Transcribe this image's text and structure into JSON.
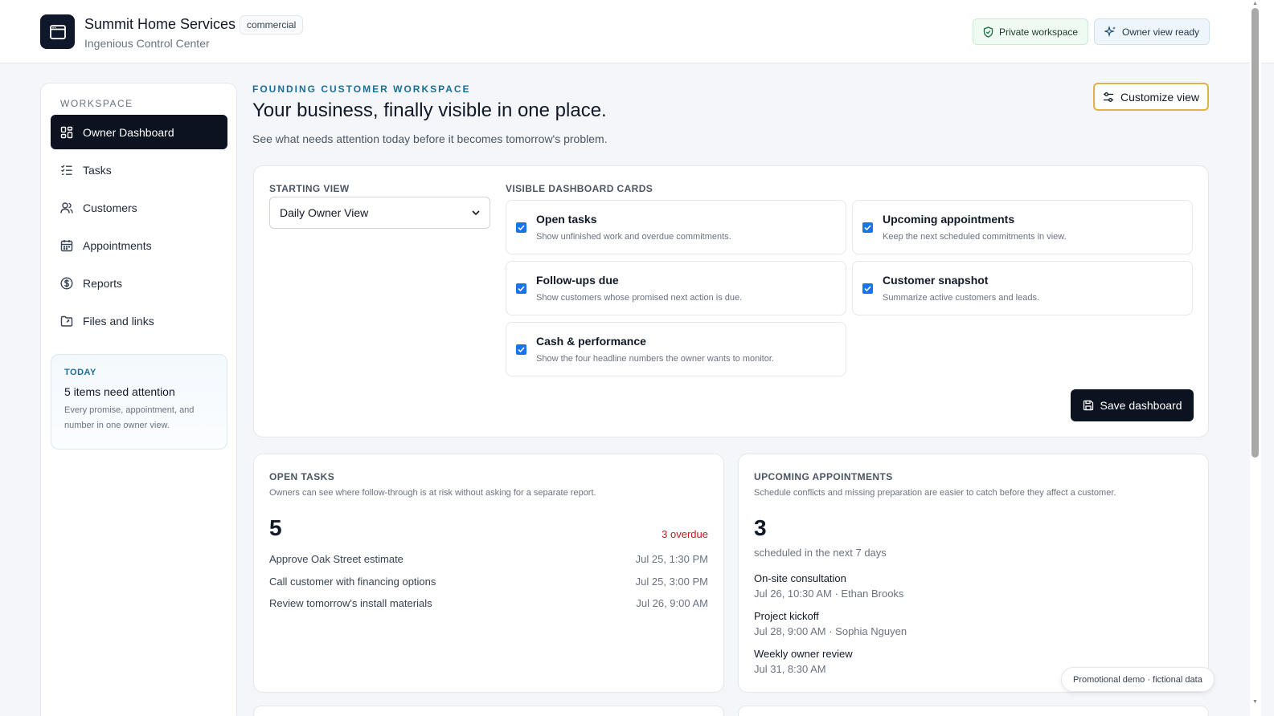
{
  "header": {
    "app_title": "Summit Home Services",
    "badge": "commercial",
    "subtitle": "Ingenious Control Center",
    "private_pill": "Private workspace",
    "owner_pill": "Owner view ready"
  },
  "sidebar": {
    "section_label": "WORKSPACE",
    "items": [
      {
        "label": "Owner Dashboard",
        "icon": "dashboard-icon",
        "active": true
      },
      {
        "label": "Tasks",
        "icon": "checklist-icon"
      },
      {
        "label": "Customers",
        "icon": "users-icon"
      },
      {
        "label": "Appointments",
        "icon": "calendar-icon"
      },
      {
        "label": "Reports",
        "icon": "dollar-circle-icon"
      },
      {
        "label": "Files and links",
        "icon": "folder-link-icon"
      }
    ],
    "today": {
      "tag": "TODAY",
      "title": "5 items need attention",
      "description": "Every promise, appointment, and number in one owner view."
    }
  },
  "main": {
    "eyebrow": "FOUNDING CUSTOMER WORKSPACE",
    "title": "Your business, finally visible in one place.",
    "subtitle": "See what needs attention today before it becomes tomorrow's problem.",
    "customize_label": "Customize view"
  },
  "settings": {
    "starting_view_label": "STARTING VIEW",
    "starting_view_value": "Daily Owner View",
    "cards_label": "VISIBLE DASHBOARD CARDS",
    "cards": [
      {
        "title": "Open tasks",
        "desc": "Show unfinished work and overdue commitments.",
        "checked": true
      },
      {
        "title": "Upcoming appointments",
        "desc": "Keep the next scheduled commitments in view.",
        "checked": true
      },
      {
        "title": "Follow-ups due",
        "desc": "Show customers whose promised next action is due.",
        "checked": true
      },
      {
        "title": "Customer snapshot",
        "desc": "Summarize active customers and leads.",
        "checked": true
      },
      {
        "title": "Cash & performance",
        "desc": "Show the four headline numbers the owner wants to monitor.",
        "checked": true
      }
    ],
    "save_label": "Save dashboard"
  },
  "open_tasks": {
    "title": "OPEN TASKS",
    "desc": "Owners can see where follow-through is at risk without asking for a separate report.",
    "count": "5",
    "overdue": "3 overdue",
    "rows": [
      {
        "name": "Approve Oak Street estimate",
        "when": "Jul 25, 1:30 PM"
      },
      {
        "name": "Call customer with financing options",
        "when": "Jul 25, 3:00 PM"
      },
      {
        "name": "Review tomorrow's install materials",
        "when": "Jul 26, 9:00 AM"
      }
    ]
  },
  "appointments": {
    "title": "UPCOMING APPOINTMENTS",
    "desc": "Schedule conflicts and missing preparation are easier to catch before they affect a customer.",
    "count": "3",
    "sub": "scheduled in the next 7 days",
    "items": [
      {
        "name": "On-site consultation",
        "meta": "Jul 26, 10:30 AM · Ethan Brooks"
      },
      {
        "name": "Project kickoff",
        "meta": "Jul 28, 9:00 AM · Sophia Nguyen"
      },
      {
        "name": "Weekly owner review",
        "meta": "Jul 31, 8:30 AM"
      }
    ]
  },
  "demo_tag": "Promotional demo · fictional data"
}
